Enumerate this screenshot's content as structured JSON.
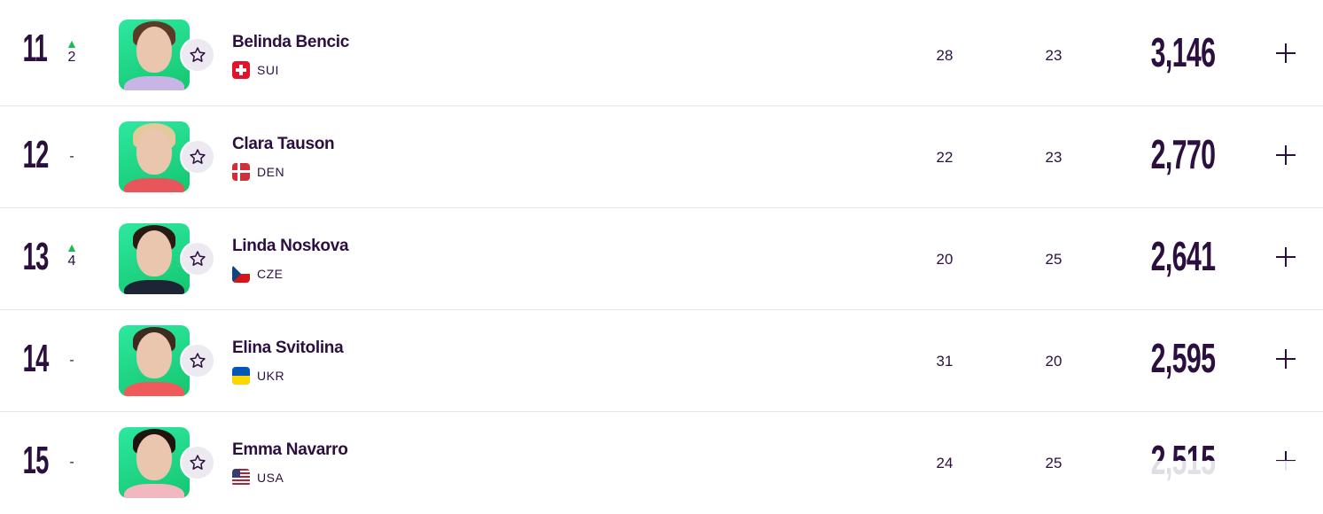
{
  "rankings": [
    {
      "rank": "11",
      "movement": {
        "dir": "up",
        "arrow": "▲",
        "value": "2"
      },
      "name": "Belinda Bencic",
      "country": "SUI",
      "age": "28",
      "tournaments": "23",
      "points": "3,146"
    },
    {
      "rank": "12",
      "movement": {
        "dir": "none",
        "arrow": "",
        "value": "-"
      },
      "name": "Clara Tauson",
      "country": "DEN",
      "age": "22",
      "tournaments": "23",
      "points": "2,770"
    },
    {
      "rank": "13",
      "movement": {
        "dir": "up",
        "arrow": "▲",
        "value": "4"
      },
      "name": "Linda Noskova",
      "country": "CZE",
      "age": "20",
      "tournaments": "25",
      "points": "2,641"
    },
    {
      "rank": "14",
      "movement": {
        "dir": "none",
        "arrow": "",
        "value": "-"
      },
      "name": "Elina Svitolina",
      "country": "UKR",
      "age": "31",
      "tournaments": "20",
      "points": "2,595"
    },
    {
      "rank": "15",
      "movement": {
        "dir": "none",
        "arrow": "",
        "value": "-"
      },
      "name": "Emma Navarro",
      "country": "USA",
      "age": "24",
      "tournaments": "25",
      "points": "2,515"
    }
  ],
  "icons": {
    "favorite": "star-outline-icon",
    "expand": "plus-icon",
    "movement_up": "triangle-up-icon"
  },
  "colors": {
    "text": "#2b0f3f",
    "up": "#1db954",
    "photo_bg": "#1fd487",
    "divider": "#e6e4ea"
  }
}
